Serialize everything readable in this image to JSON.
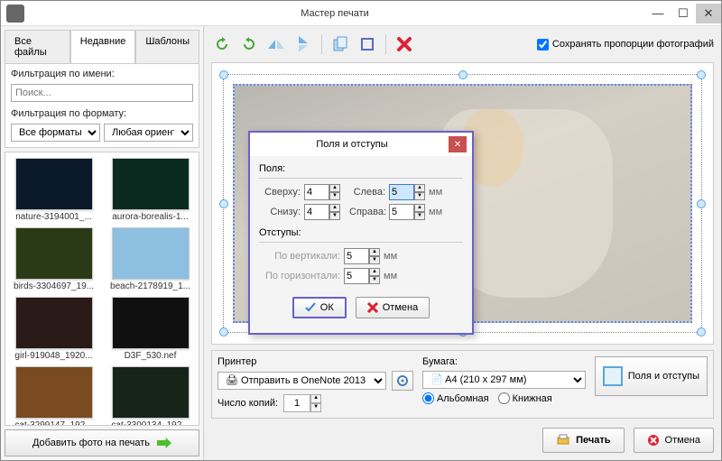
{
  "window": {
    "title": "Мастер печати"
  },
  "tabs": {
    "all": "Все файлы",
    "recent": "Недавние",
    "templates": "Шаблоны"
  },
  "filters": {
    "name_label": "Фильтрация по имени:",
    "name_placeholder": "Поиск...",
    "format_label": "Фильтрация по формату:",
    "format_value": "Все форматы",
    "orient_value": "Любая ориентация"
  },
  "thumbs": [
    {
      "caption": "nature-3194001_..."
    },
    {
      "caption": "aurora-borealis-1..."
    },
    {
      "caption": "birds-3304697_19..."
    },
    {
      "caption": "beach-2178919_1..."
    },
    {
      "caption": "girl-919048_1920..."
    },
    {
      "caption": "D3F_530.nef"
    },
    {
      "caption": "cat-3299147_192..."
    },
    {
      "caption": "cat-3300134_192..."
    }
  ],
  "add_button": "Добавить фото на печать",
  "toolbar": {
    "preserve_label": "Сохранять пропорции фотографий",
    "preserve_checked": true
  },
  "dialog": {
    "title": "Поля и отступы",
    "sec_margins": "Поля:",
    "top": "Сверху:",
    "top_v": "4",
    "left": "Слева:",
    "left_v": "5",
    "bottom": "Снизу:",
    "bottom_v": "4",
    "right": "Справа:",
    "right_v": "5",
    "unit": "мм",
    "sec_gaps": "Отступы:",
    "vgap": "По вертикали:",
    "vgap_v": "5",
    "hgap": "По горизонтали:",
    "hgap_v": "5",
    "ok": "ОК",
    "cancel": "Отмена"
  },
  "bottom": {
    "printer_label": "Принтер",
    "printer_value": "Отправить в OneNote 2013",
    "copies_label": "Число копий:",
    "copies_value": "1",
    "paper_label": "Бумага:",
    "paper_value": "A4 (210 x 297 мм)",
    "orient_landscape": "Альбомная",
    "orient_portrait": "Книжная",
    "margins_btn": "Поля и отступы",
    "print": "Печать",
    "cancel": "Отмена"
  },
  "thumb_colors": [
    "#0a1a2a",
    "#0a2a20",
    "#2a3a16",
    "#8dbfe0",
    "#2a1a18",
    "#101010",
    "#7a4a20",
    "#16241a"
  ]
}
